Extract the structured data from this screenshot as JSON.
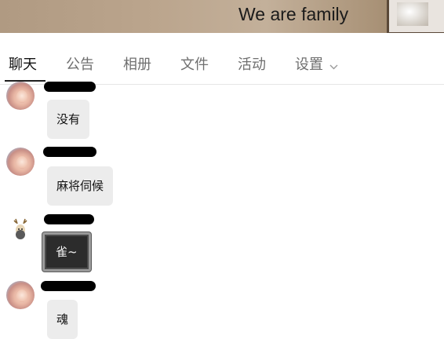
{
  "header": {
    "title": "We are family"
  },
  "tabs": [
    {
      "label": "聊天",
      "active": true
    },
    {
      "label": "公告",
      "active": false
    },
    {
      "label": "相册",
      "active": false
    },
    {
      "label": "文件",
      "active": false
    },
    {
      "label": "活动",
      "active": false
    },
    {
      "label": "设置",
      "active": false,
      "has_dropdown": true,
      "icon": "chevron-down-icon"
    }
  ],
  "chat": {
    "messages": [
      {
        "avatar": "girl-avatar",
        "sender_redacted": true,
        "text": "没有"
      },
      {
        "avatar": "girl-avatar",
        "sender_redacted": true,
        "text": "麻将伺候"
      },
      {
        "avatar": "deer-avatar",
        "sender_redacted": true,
        "text": "雀~",
        "bubble_style": "dark"
      },
      {
        "avatar": "girl-avatar",
        "sender_redacted": true,
        "text": "魂"
      }
    ]
  },
  "colors": {
    "banner": "#bba58d",
    "tab_active": "#111111",
    "tab_inactive": "#6f6f6f",
    "bubble": "#ececec",
    "bubble_dark": "#2c2c2c"
  }
}
